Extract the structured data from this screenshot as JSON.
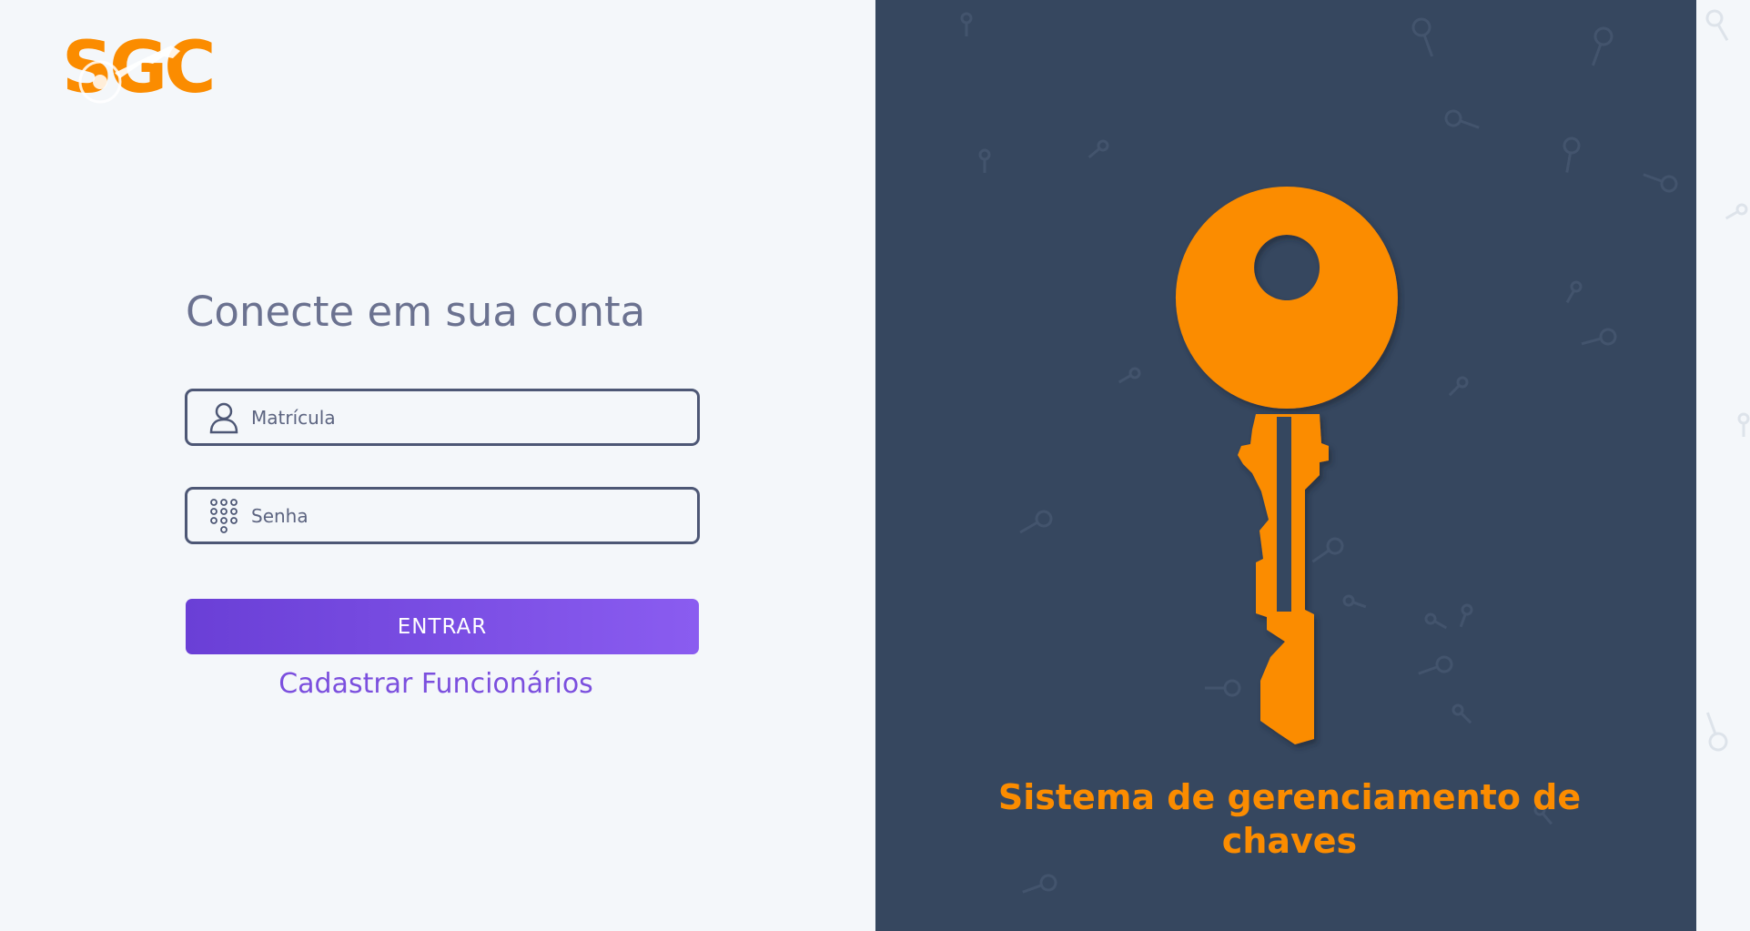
{
  "brand": {
    "logo_text": "SGC",
    "accent_color": "#fb8c00",
    "panel_color": "#36475f",
    "button_gradient": [
      "#6a3fd6",
      "#8a5cf0"
    ]
  },
  "login": {
    "title": "Conecte em sua conta",
    "username": {
      "placeholder": "Matrícula",
      "value": "",
      "icon": "user-icon"
    },
    "password": {
      "placeholder": "Senha",
      "value": "",
      "icon": "keypad-icon"
    },
    "submit_label": "ENTRAR",
    "register_link": "Cadastrar Funcionários"
  },
  "showcase": {
    "icon": "key-illustration",
    "tagline_line1": "Sistema de gerenciamento de",
    "tagline_line2": "chaves"
  }
}
